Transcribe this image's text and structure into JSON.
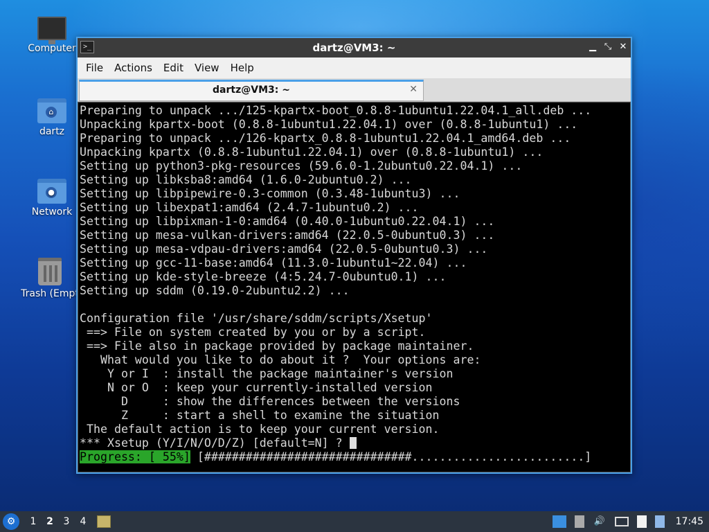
{
  "desktop": {
    "icons": [
      {
        "label": "Computer"
      },
      {
        "label": "dartz"
      },
      {
        "label": "Network"
      },
      {
        "label": "Trash (Empt"
      }
    ]
  },
  "window": {
    "title": "dartz@VM3: ~",
    "app_icon": ">_",
    "controls": {
      "minimize": "▁",
      "maximize": "⤡",
      "close": "✕"
    },
    "menu": [
      "File",
      "Actions",
      "Edit",
      "View",
      "Help"
    ],
    "tab": {
      "label": "dartz@VM3: ~",
      "close": "✕"
    }
  },
  "terminal": {
    "lines": [
      "Preparing to unpack .../125-kpartx-boot_0.8.8-1ubuntu1.22.04.1_all.deb ...",
      "Unpacking kpartx-boot (0.8.8-1ubuntu1.22.04.1) over (0.8.8-1ubuntu1) ...",
      "Preparing to unpack .../126-kpartx_0.8.8-1ubuntu1.22.04.1_amd64.deb ...",
      "Unpacking kpartx (0.8.8-1ubuntu1.22.04.1) over (0.8.8-1ubuntu1) ...",
      "Setting up python3-pkg-resources (59.6.0-1.2ubuntu0.22.04.1) ...",
      "Setting up libksba8:amd64 (1.6.0-2ubuntu0.2) ...",
      "Setting up libpipewire-0.3-common (0.3.48-1ubuntu3) ...",
      "Setting up libexpat1:amd64 (2.4.7-1ubuntu0.2) ...",
      "Setting up libpixman-1-0:amd64 (0.40.0-1ubuntu0.22.04.1) ...",
      "Setting up mesa-vulkan-drivers:amd64 (22.0.5-0ubuntu0.3) ...",
      "Setting up mesa-vdpau-drivers:amd64 (22.0.5-0ubuntu0.3) ...",
      "Setting up gcc-11-base:amd64 (11.3.0-1ubuntu1~22.04) ...",
      "Setting up kde-style-breeze (4:5.24.7-0ubuntu0.1) ...",
      "Setting up sddm (0.19.0-2ubuntu2.2) ...",
      "",
      "Configuration file '/usr/share/sddm/scripts/Xsetup'",
      " ==> File on system created by you or by a script.",
      " ==> File also in package provided by package maintainer.",
      "   What would you like to do about it ?  Your options are:",
      "    Y or I  : install the package maintainer's version",
      "    N or O  : keep your currently-installed version",
      "      D     : show the differences between the versions",
      "      Z     : start a shell to examine the situation",
      " The default action is to keep your current version.",
      "*** Xsetup (Y/I/N/O/D/Z) [default=N] ? "
    ],
    "progress": {
      "label": "Progress: [ 55%]",
      "bar": " [##############################.........................]"
    }
  },
  "taskbar": {
    "start_icon": "⚙",
    "workspaces": [
      "1",
      "2",
      "3",
      "4"
    ],
    "active_workspace": "2",
    "clock": "17:45"
  }
}
